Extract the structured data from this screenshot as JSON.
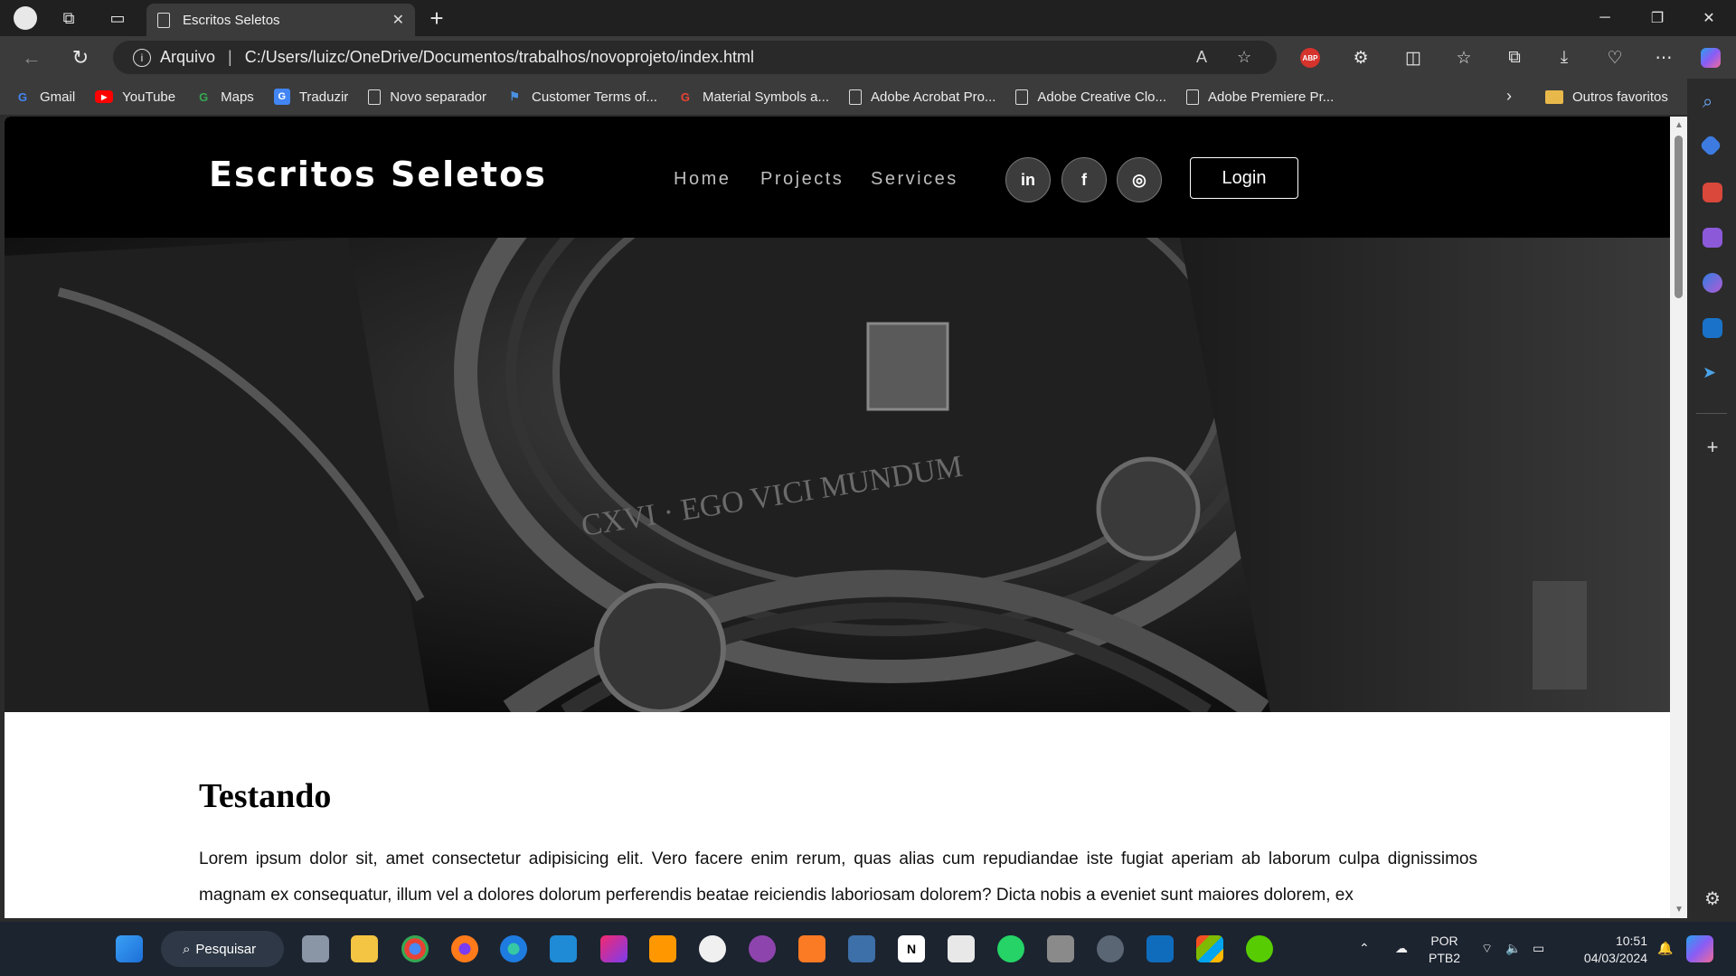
{
  "browser": {
    "tab_title": "Escritos Seletos",
    "address_label": "Arquivo",
    "address_url": "C:/Users/luizc/OneDrive/Documentos/trabalhos/novoprojeto/index.html",
    "abp_label": "ABP",
    "bookmarks": [
      {
        "label": "Gmail",
        "icon": "G"
      },
      {
        "label": "YouTube",
        "icon": "▶"
      },
      {
        "label": "Maps",
        "icon": "G"
      },
      {
        "label": "Traduzir",
        "icon": "G"
      },
      {
        "label": "Novo separador",
        "icon": "page"
      },
      {
        "label": "Customer Terms of...",
        "icon": "flag"
      },
      {
        "label": "Material Symbols a...",
        "icon": "G"
      },
      {
        "label": "Adobe Acrobat Pro...",
        "icon": "page"
      },
      {
        "label": "Adobe Creative Clo...",
        "icon": "page"
      },
      {
        "label": "Adobe Premiere Pr...",
        "icon": "page"
      }
    ],
    "other_favorites": "Outros favoritos"
  },
  "site": {
    "brand": "Escritos Seletos",
    "nav": [
      "Home",
      "Projects",
      "Services"
    ],
    "social": [
      "in",
      "f",
      "◎"
    ],
    "login": "Login",
    "hero_inscription": "CXVI · EGO VICI MUNDUM",
    "heading": "Testando",
    "paragraph": "Lorem ipsum dolor sit, amet consectetur adipisicing elit. Vero facere enim rerum, quas alias cum repudiandae iste fugiat aperiam ab laborum culpa dignissimos magnam ex consequatur, illum vel a dolores dolorum perferendis beatae reiciendis laboriosam dolorem? Dicta nobis a eveniet sunt maiores dolorem, ex"
  },
  "taskbar": {
    "search": "Pesquisar",
    "lang_top": "POR",
    "lang_bottom": "PTB2",
    "time": "10:51",
    "date": "04/03/2024"
  },
  "colors": {
    "header_bg": "#000000",
    "browser_chrome": "#3b3b3b",
    "taskbar": "#1c2430",
    "abp_red": "#d6332d"
  }
}
